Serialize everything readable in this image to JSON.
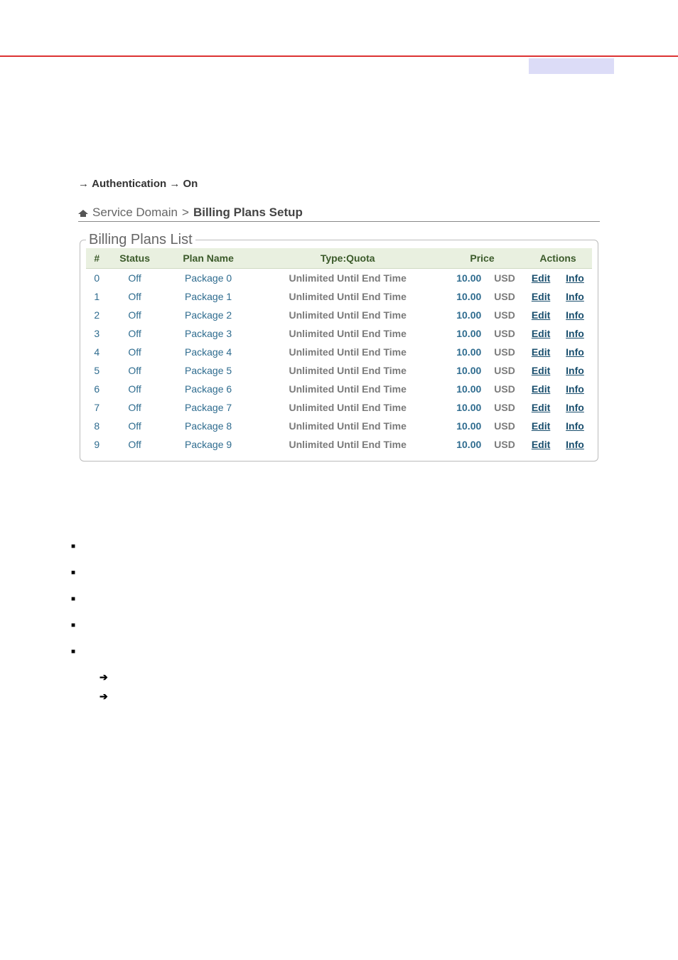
{
  "nav": {
    "arrow1": "→",
    "auth": "Authentication",
    "arrow2": "→",
    "on": "On"
  },
  "breadcrumb": {
    "level1": "Service Domain",
    "sep": ">",
    "level2": "Billing Plans Setup"
  },
  "panel": {
    "legend": "Billing Plans List"
  },
  "table": {
    "headers": {
      "num": "#",
      "status": "Status",
      "plan_name": "Plan Name",
      "type_quota": "Type:Quota",
      "price": "Price",
      "actions": "Actions"
    },
    "edit_label": "Edit",
    "info_label": "Info",
    "rows": [
      {
        "num": "0",
        "status": "Off",
        "name": "Package 0",
        "quota": "Unlimited Until End Time",
        "price": "10.00",
        "curr": "USD"
      },
      {
        "num": "1",
        "status": "Off",
        "name": "Package 1",
        "quota": "Unlimited Until End Time",
        "price": "10.00",
        "curr": "USD"
      },
      {
        "num": "2",
        "status": "Off",
        "name": "Package 2",
        "quota": "Unlimited Until End Time",
        "price": "10.00",
        "curr": "USD"
      },
      {
        "num": "3",
        "status": "Off",
        "name": "Package 3",
        "quota": "Unlimited Until End Time",
        "price": "10.00",
        "curr": "USD"
      },
      {
        "num": "4",
        "status": "Off",
        "name": "Package 4",
        "quota": "Unlimited Until End Time",
        "price": "10.00",
        "curr": "USD"
      },
      {
        "num": "5",
        "status": "Off",
        "name": "Package 5",
        "quota": "Unlimited Until End Time",
        "price": "10.00",
        "curr": "USD"
      },
      {
        "num": "6",
        "status": "Off",
        "name": "Package 6",
        "quota": "Unlimited Until End Time",
        "price": "10.00",
        "curr": "USD"
      },
      {
        "num": "7",
        "status": "Off",
        "name": "Package 7",
        "quota": "Unlimited Until End Time",
        "price": "10.00",
        "curr": "USD"
      },
      {
        "num": "8",
        "status": "Off",
        "name": "Package 8",
        "quota": "Unlimited Until End Time",
        "price": "10.00",
        "curr": "USD"
      },
      {
        "num": "9",
        "status": "Off",
        "name": "Package 9",
        "quota": "Unlimited Until End Time",
        "price": "10.00",
        "curr": "USD"
      }
    ]
  }
}
